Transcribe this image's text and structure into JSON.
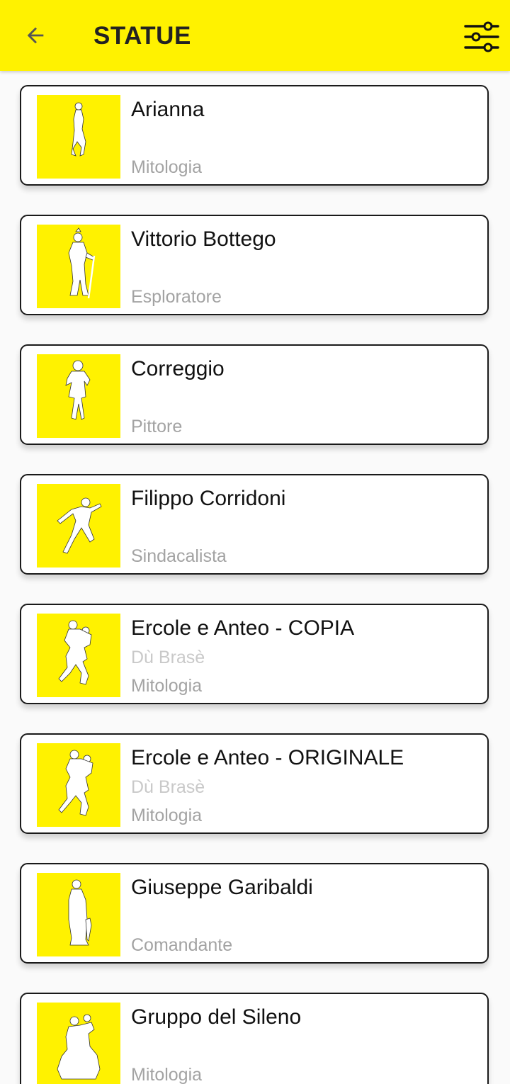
{
  "header": {
    "title": "STATUE",
    "back_icon": "arrow-back-icon",
    "filter_icon": "filter-sliders-icon",
    "bar_color": "#fff200"
  },
  "statues": [
    {
      "name": "Arianna",
      "alias": "",
      "category": "Mitologia",
      "figure": "standing-woman"
    },
    {
      "name": "Vittorio Bottego",
      "alias": "",
      "category": "Esploratore",
      "figure": "explorer-with-staff"
    },
    {
      "name": "Correggio",
      "alias": "",
      "category": "Pittore",
      "figure": "painter-standing"
    },
    {
      "name": "Filippo Corridoni",
      "alias": "",
      "category": "Sindacalista",
      "figure": "running-man"
    },
    {
      "name": "Ercole e Anteo - COPIA",
      "alias": "Dù Brasè",
      "category": "Mitologia",
      "figure": "two-wrestlers"
    },
    {
      "name": "Ercole e Anteo - ORIGINALE",
      "alias": "Dù Brasè",
      "category": "Mitologia",
      "figure": "two-wrestlers"
    },
    {
      "name": "Giuseppe Garibaldi",
      "alias": "",
      "category": "Comandante",
      "figure": "cloaked-man"
    },
    {
      "name": "Gruppo del Sileno",
      "alias": "",
      "category": "Mitologia",
      "figure": "group-figures"
    }
  ]
}
